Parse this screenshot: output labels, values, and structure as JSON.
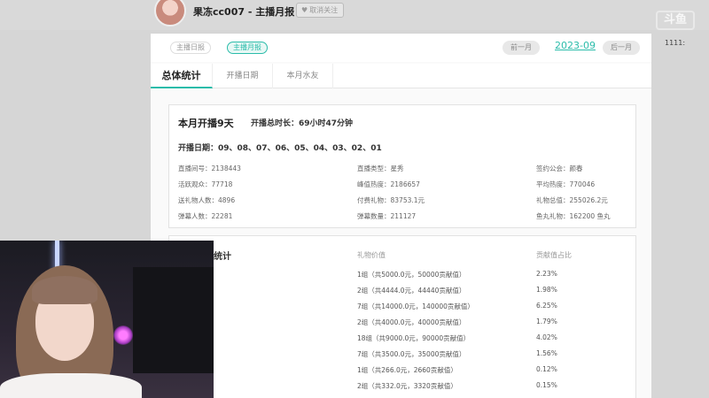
{
  "header": {
    "streamer_title": "果冻cc007 - 主播月报",
    "follow_label": "取消关注"
  },
  "logo": {
    "text": "斗鱼",
    "sub": "1111:"
  },
  "report_nav": {
    "daily_label": "主播日报",
    "monthly_label": "主播月报",
    "prev_label": "前一月",
    "month": "2023-09",
    "next_label": "后一月"
  },
  "tabs": [
    {
      "label": "总体统计"
    },
    {
      "label": "开播日期"
    },
    {
      "label": "本月水友"
    }
  ],
  "summary": {
    "title": "本月开播9天",
    "duration": "开播总时长：69小时47分钟",
    "dates": "开播日期：09、08、07、06、05、04、03、02、01",
    "stats": [
      {
        "text": "直播间号：2138443"
      },
      {
        "text": "直播类型：星秀"
      },
      {
        "text": "签约公会：颜春"
      },
      {
        "text": "活跃观众：77718"
      },
      {
        "text": "峰值热度：2186657"
      },
      {
        "text": "平均热度：770046"
      },
      {
        "text": "送礼物人数：4896"
      },
      {
        "text": "付费礼物：83753.1元"
      },
      {
        "text": "礼物总值：255026.2元"
      },
      {
        "text": "弹幕人数：22281"
      },
      {
        "text": "弹幕数量：211127"
      },
      {
        "text": "鱼丸礼物：162200 鱼丸"
      }
    ]
  },
  "gifts": {
    "title": "物统计",
    "col_value": "礼物价值",
    "col_share": "贡献值占比",
    "rows": [
      {
        "value": "1组（共5000.0元，50000贡献值）",
        "share": "2.23%"
      },
      {
        "value": "2组（共4444.0元，44440贡献值）",
        "share": "1.98%"
      },
      {
        "value": "7组（共14000.0元，140000贡献值）",
        "share": "6.25%"
      },
      {
        "value": "2组（共4000.0元，40000贡献值）",
        "share": "1.79%"
      },
      {
        "value": "18组（共9000.0元，90000贡献值）",
        "share": "4.02%"
      },
      {
        "value": "7组（共3500.0元，35000贡献值）",
        "share": "1.56%"
      },
      {
        "value": "1组（共266.0元，2660贡献值）",
        "share": "0.12%"
      },
      {
        "value": "2组（共332.0元，3320贡献值）",
        "share": "0.15%"
      }
    ]
  }
}
